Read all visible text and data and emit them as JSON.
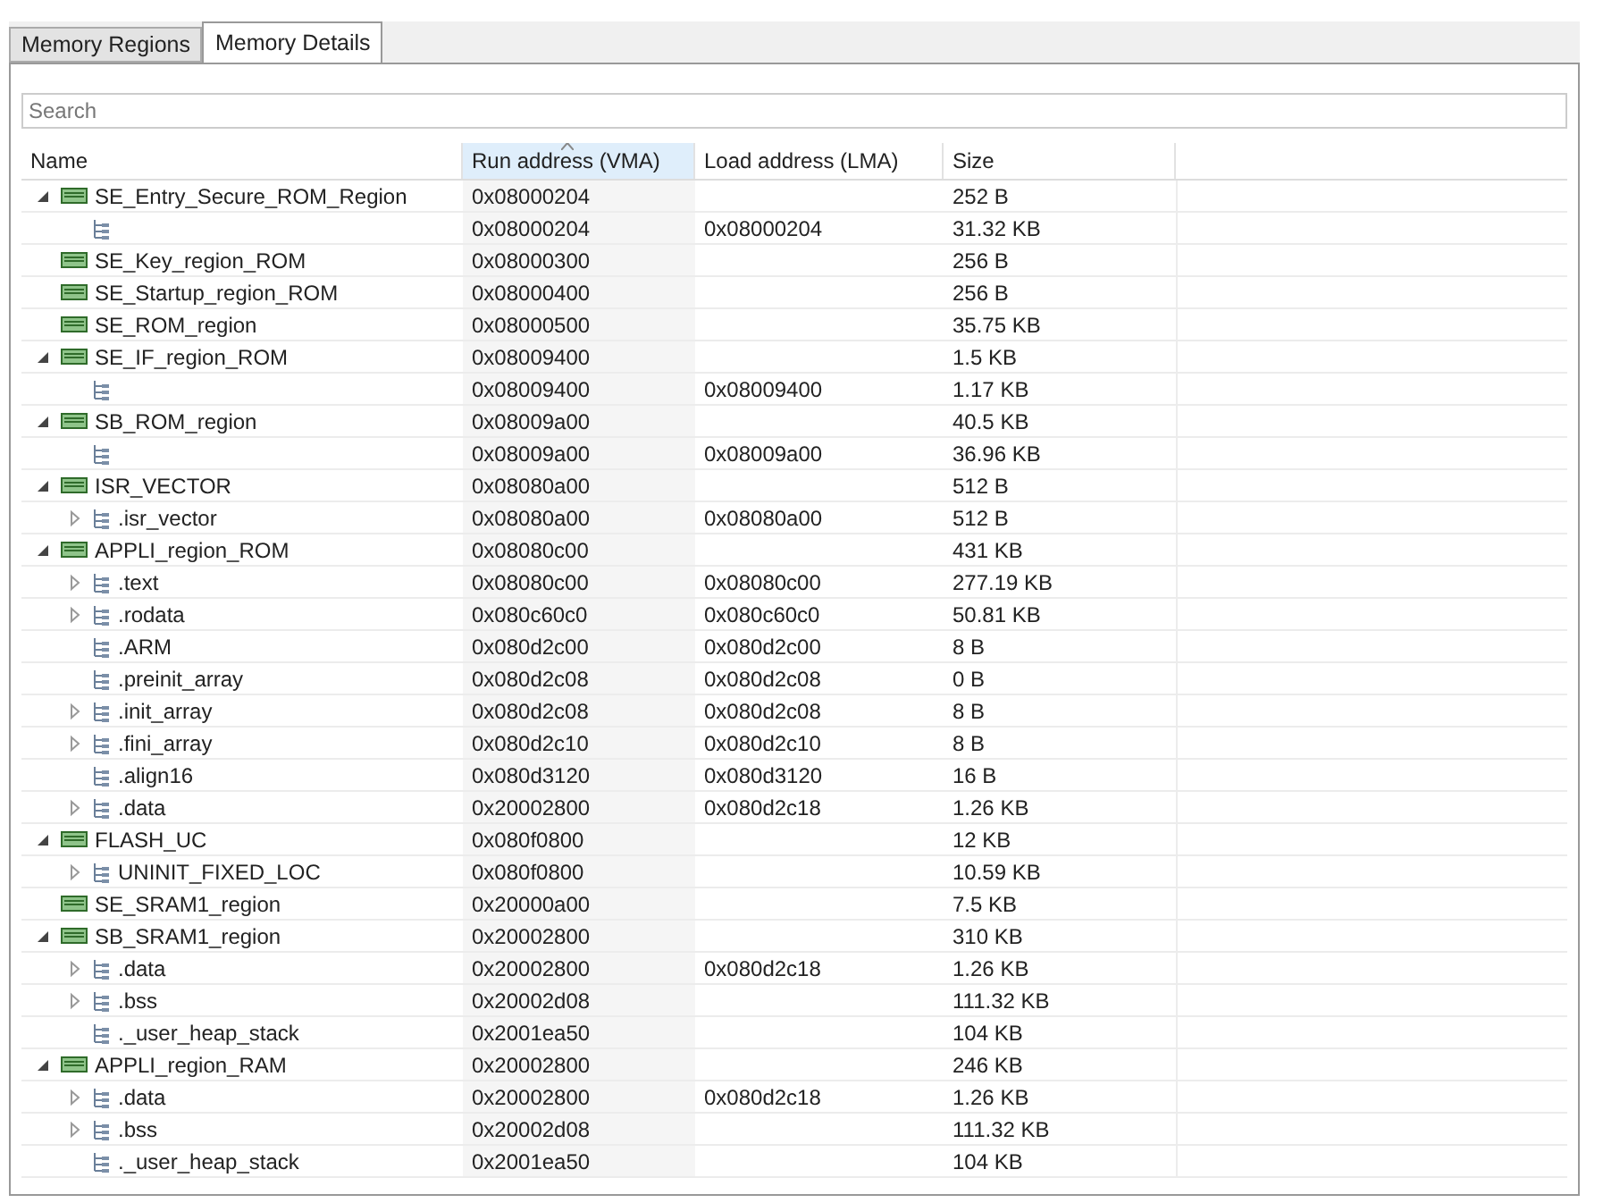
{
  "tabs": [
    {
      "label": "Memory Regions",
      "selected": false
    },
    {
      "label": "Memory Details",
      "selected": true
    }
  ],
  "search": {
    "placeholder": "Search"
  },
  "table": {
    "columns": [
      {
        "label": "Name",
        "sorted": false
      },
      {
        "label": "Run address (VMA)",
        "sorted": true
      },
      {
        "label": "Load address (LMA)",
        "sorted": false
      },
      {
        "label": "Size",
        "sorted": false
      }
    ],
    "rows": [
      {
        "kind": "region",
        "name": "SE_Entry_Secure_ROM_Region",
        "vma": "0x08000204",
        "size": "252 B",
        "expanded": true,
        "children": [
          {
            "kind": "section",
            "vma": "0x08000204",
            "lma": "0x08000204",
            "size": "31.32 KB"
          }
        ]
      },
      {
        "kind": "region",
        "name": "SE_Key_region_ROM",
        "vma": "0x08000300",
        "size": "256 B"
      },
      {
        "kind": "region",
        "name": "SE_Startup_region_ROM",
        "vma": "0x08000400",
        "size": "256 B"
      },
      {
        "kind": "region",
        "name": "SE_ROM_region",
        "vma": "0x08000500",
        "size": "35.75 KB"
      },
      {
        "kind": "region",
        "name": "SE_IF_region_ROM",
        "vma": "0x08009400",
        "size": "1.5 KB",
        "expanded": true,
        "children": [
          {
            "kind": "section",
            "vma": "0x08009400",
            "lma": "0x08009400",
            "size": "1.17 KB"
          }
        ]
      },
      {
        "kind": "region",
        "name": "SB_ROM_region",
        "vma": "0x08009a00",
        "size": "40.5 KB",
        "expanded": true,
        "children": [
          {
            "kind": "section",
            "vma": "0x08009a00",
            "lma": "0x08009a00",
            "size": "36.96 KB"
          }
        ]
      },
      {
        "kind": "region",
        "name": "ISR_VECTOR",
        "vma": "0x08080a00",
        "size": "512 B",
        "expanded": true,
        "children": [
          {
            "kind": "section",
            "name": ".isr_vector",
            "vma": "0x08080a00",
            "lma": "0x08080a00",
            "size": "512 B",
            "expanded": false
          }
        ]
      },
      {
        "kind": "region",
        "name": "APPLI_region_ROM",
        "vma": "0x08080c00",
        "size": "431 KB",
        "expanded": true,
        "children": [
          {
            "kind": "section",
            "name": ".text",
            "vma": "0x08080c00",
            "lma": "0x08080c00",
            "size": "277.19 KB",
            "expanded": false
          },
          {
            "kind": "section",
            "name": ".rodata",
            "vma": "0x080c60c0",
            "lma": "0x080c60c0",
            "size": "50.81 KB",
            "expanded": false
          },
          {
            "kind": "section",
            "name": ".ARM",
            "vma": "0x080d2c00",
            "lma": "0x080d2c00",
            "size": "8 B"
          },
          {
            "kind": "section",
            "name": ".preinit_array",
            "vma": "0x080d2c08",
            "lma": "0x080d2c08",
            "size": "0 B"
          },
          {
            "kind": "section",
            "name": ".init_array",
            "vma": "0x080d2c08",
            "lma": "0x080d2c08",
            "size": "8 B",
            "expanded": false
          },
          {
            "kind": "section",
            "name": ".fini_array",
            "vma": "0x080d2c10",
            "lma": "0x080d2c10",
            "size": "8 B",
            "expanded": false
          },
          {
            "kind": "section",
            "name": ".align16",
            "vma": "0x080d3120",
            "lma": "0x080d3120",
            "size": "16 B"
          },
          {
            "kind": "section",
            "name": ".data",
            "vma": "0x20002800",
            "lma": "0x080d2c18",
            "size": "1.26 KB",
            "expanded": false
          }
        ]
      },
      {
        "kind": "region",
        "name": "FLASH_UC",
        "vma": "0x080f0800",
        "size": "12 KB",
        "expanded": true,
        "children": [
          {
            "kind": "section",
            "name": "UNINIT_FIXED_LOC",
            "vma": "0x080f0800",
            "size": "10.59 KB",
            "expanded": false
          }
        ]
      },
      {
        "kind": "region",
        "name": "SE_SRAM1_region",
        "vma": "0x20000a00",
        "size": "7.5 KB"
      },
      {
        "kind": "region",
        "name": "SB_SRAM1_region",
        "vma": "0x20002800",
        "size": "310 KB",
        "expanded": true,
        "children": [
          {
            "kind": "section",
            "name": ".data",
            "vma": "0x20002800",
            "lma": "0x080d2c18",
            "size": "1.26 KB",
            "expanded": false
          },
          {
            "kind": "section",
            "name": ".bss",
            "vma": "0x20002d08",
            "size": "111.32 KB",
            "expanded": false
          },
          {
            "kind": "section",
            "name": "._user_heap_stack",
            "vma": "0x2001ea50",
            "size": "104 KB"
          }
        ]
      },
      {
        "kind": "region",
        "name": "APPLI_region_RAM",
        "vma": "0x20002800",
        "size": "246 KB",
        "expanded": true,
        "children": [
          {
            "kind": "section",
            "name": ".data",
            "vma": "0x20002800",
            "lma": "0x080d2c18",
            "size": "1.26 KB",
            "expanded": false
          },
          {
            "kind": "section",
            "name": ".bss",
            "vma": "0x20002d08",
            "size": "111.32 KB",
            "expanded": false
          },
          {
            "kind": "section",
            "name": "._user_heap_stack",
            "vma": "0x2001ea50",
            "size": "104 KB"
          }
        ]
      }
    ]
  }
}
